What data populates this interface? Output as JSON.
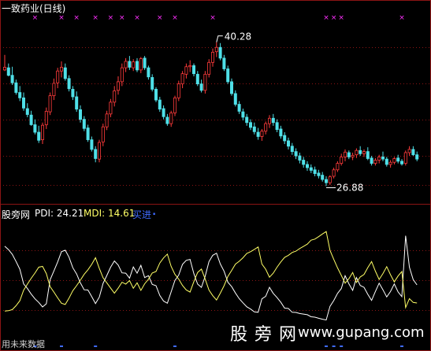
{
  "price_panel": {
    "title": "一致药业(日线)",
    "high_label": "40.28",
    "low_label": "26.88",
    "up_color": "#ff3b3b",
    "down_color": "#4fe0e8",
    "marker_color": "#ff30ff",
    "grid_color": "#8b1414"
  },
  "indicator_panel": {
    "name": "股旁网",
    "pdi_label": "PDI: 24.21",
    "mdi_label": "MDI: 14.61",
    "signal_label": "买进",
    "signal_arrow": "⬝",
    "pdi_color": "#ffffff",
    "mdi_color": "#ffff66",
    "signal_color": "#3f6bff"
  },
  "footer": {
    "left_caption": "用未来数据"
  },
  "watermark": {
    "cn": "股 旁 网",
    "url": "www.gupang.com"
  },
  "chart_data": [
    {
      "type": "candlestick",
      "title": "一致药业(日线)",
      "ylim": [
        25.6,
        42.6
      ],
      "ohlc": [
        [
          37.7,
          39.1,
          37.6,
          37.95
        ],
        [
          37.9,
          38.3,
          37.1,
          37.2
        ],
        [
          37.2,
          38.0,
          36.3,
          36.5
        ],
        [
          36.5,
          36.8,
          35.4,
          35.6
        ],
        [
          35.6,
          36.2,
          34.8,
          35.1
        ],
        [
          35.1,
          35.6,
          33.9,
          34.15
        ],
        [
          34.1,
          34.6,
          33.3,
          33.55
        ],
        [
          33.5,
          33.9,
          32.5,
          32.6
        ],
        [
          32.6,
          33.1,
          31.7,
          31.9
        ],
        [
          31.9,
          32.5,
          30.9,
          31.15
        ],
        [
          31.2,
          32.8,
          30.8,
          32.55
        ],
        [
          32.6,
          34.2,
          32.2,
          33.85
        ],
        [
          33.8,
          35.6,
          33.5,
          35.3
        ],
        [
          35.3,
          36.9,
          34.9,
          36.45
        ],
        [
          36.5,
          37.9,
          36.0,
          37.6
        ],
        [
          37.6,
          38.5,
          37.0,
          37.95
        ],
        [
          37.9,
          38.3,
          36.7,
          36.9
        ],
        [
          36.9,
          37.2,
          35.7,
          35.95
        ],
        [
          35.9,
          36.2,
          34.9,
          35.2
        ],
        [
          35.2,
          35.7,
          33.8,
          34.05
        ],
        [
          34.0,
          34.4,
          32.8,
          33.1
        ],
        [
          33.1,
          33.4,
          32.0,
          32.25
        ],
        [
          32.3,
          32.6,
          31.0,
          31.2
        ],
        [
          31.2,
          31.5,
          30.1,
          30.3
        ],
        [
          30.3,
          30.6,
          29.1,
          29.45
        ],
        [
          29.4,
          31.2,
          29.1,
          30.95
        ],
        [
          31.0,
          32.7,
          30.6,
          32.4
        ],
        [
          32.4,
          33.9,
          32.1,
          33.6
        ],
        [
          33.6,
          35.0,
          33.3,
          34.7
        ],
        [
          34.7,
          36.2,
          34.3,
          35.75
        ],
        [
          35.8,
          37.1,
          35.4,
          36.6
        ],
        [
          36.6,
          38.3,
          36.2,
          37.9
        ],
        [
          37.9,
          38.8,
          37.5,
          38.5
        ],
        [
          38.5,
          39.0,
          37.7,
          37.95
        ],
        [
          37.9,
          38.7,
          37.6,
          38.45
        ],
        [
          38.5,
          38.8,
          37.5,
          37.7
        ],
        [
          37.7,
          38.9,
          37.4,
          38.75
        ],
        [
          38.8,
          39.0,
          37.7,
          37.9
        ],
        [
          37.9,
          38.1,
          36.8,
          37.05
        ],
        [
          37.0,
          37.3,
          35.7,
          35.9
        ],
        [
          35.9,
          36.1,
          34.7,
          34.9
        ],
        [
          34.9,
          35.2,
          33.8,
          34.05
        ],
        [
          34.1,
          34.4,
          33.1,
          33.35
        ],
        [
          33.3,
          33.6,
          32.5,
          32.7
        ],
        [
          32.7,
          33.9,
          32.4,
          33.7
        ],
        [
          33.7,
          35.3,
          33.4,
          35.1
        ],
        [
          35.1,
          36.7,
          34.8,
          36.4
        ],
        [
          36.4,
          37.6,
          36.0,
          37.35
        ],
        [
          37.3,
          38.3,
          36.9,
          38.0
        ],
        [
          38.0,
          38.6,
          37.5,
          38.1
        ],
        [
          38.1,
          38.3,
          37.1,
          37.35
        ],
        [
          37.3,
          37.6,
          36.2,
          36.4
        ],
        [
          36.4,
          36.8,
          35.6,
          35.8
        ],
        [
          35.8,
          37.6,
          35.5,
          37.3
        ],
        [
          37.3,
          38.7,
          37.0,
          38.4
        ],
        [
          38.4,
          39.7,
          38.0,
          39.35
        ],
        [
          39.4,
          40.28,
          38.9,
          39.8
        ],
        [
          39.8,
          40.2,
          38.6,
          38.8
        ],
        [
          38.8,
          39.1,
          37.6,
          37.8
        ],
        [
          37.8,
          38.1,
          36.4,
          36.6
        ],
        [
          36.6,
          36.9,
          35.3,
          35.5
        ],
        [
          35.5,
          35.8,
          34.3,
          34.5
        ],
        [
          34.5,
          34.8,
          33.6,
          33.85
        ],
        [
          33.8,
          34.1,
          33.0,
          33.3
        ],
        [
          33.3,
          33.6,
          32.5,
          32.8
        ],
        [
          32.8,
          33.1,
          32.1,
          32.35
        ],
        [
          32.4,
          32.8,
          31.7,
          31.95
        ],
        [
          31.9,
          32.3,
          31.2,
          31.5
        ],
        [
          31.5,
          32.2,
          31.1,
          32.0
        ],
        [
          32.0,
          32.9,
          31.7,
          32.7
        ],
        [
          32.7,
          33.5,
          32.3,
          33.2
        ],
        [
          33.2,
          33.6,
          32.5,
          32.8
        ],
        [
          32.8,
          33.1,
          31.9,
          32.15
        ],
        [
          32.2,
          32.5,
          31.3,
          31.55
        ],
        [
          31.6,
          31.9,
          30.8,
          31.1
        ],
        [
          31.1,
          31.4,
          30.3,
          30.6
        ],
        [
          30.6,
          30.9,
          29.8,
          30.1
        ],
        [
          30.1,
          30.4,
          29.4,
          29.7
        ],
        [
          29.7,
          30.0,
          29.0,
          29.3
        ],
        [
          29.3,
          29.6,
          28.6,
          28.9
        ],
        [
          28.9,
          29.2,
          28.3,
          28.6
        ],
        [
          28.6,
          28.9,
          28.1,
          28.35
        ],
        [
          28.4,
          28.7,
          27.8,
          28.05
        ],
        [
          28.1,
          28.4,
          27.6,
          27.85
        ],
        [
          27.9,
          28.2,
          27.3,
          27.5
        ],
        [
          27.5,
          27.8,
          26.88,
          27.2
        ],
        [
          27.2,
          27.9,
          27.0,
          27.75
        ],
        [
          27.8,
          28.6,
          27.6,
          28.4
        ],
        [
          28.4,
          29.2,
          28.2,
          29.0
        ],
        [
          29.0,
          29.9,
          28.8,
          29.6
        ],
        [
          29.6,
          30.3,
          29.2,
          30.05
        ],
        [
          30.0,
          30.2,
          29.4,
          29.6
        ],
        [
          29.6,
          30.0,
          29.3,
          29.75
        ],
        [
          29.8,
          30.4,
          29.5,
          30.2
        ],
        [
          30.2,
          30.6,
          29.7,
          29.9
        ],
        [
          29.9,
          30.3,
          29.6,
          30.1
        ],
        [
          30.1,
          30.5,
          29.3,
          29.45
        ],
        [
          29.5,
          29.7,
          28.8,
          29.0
        ],
        [
          29.0,
          29.5,
          28.8,
          29.3
        ],
        [
          29.3,
          29.8,
          29.0,
          29.6
        ],
        [
          29.6,
          30.1,
          29.2,
          29.4
        ],
        [
          29.4,
          29.6,
          28.7,
          28.9
        ],
        [
          28.9,
          29.3,
          28.6,
          29.1
        ],
        [
          29.1,
          29.6,
          28.9,
          29.45
        ],
        [
          29.5,
          29.8,
          29.0,
          29.2
        ],
        [
          29.2,
          29.4,
          28.8,
          28.95
        ],
        [
          29.0,
          30.2,
          28.8,
          30.0
        ],
        [
          30.0,
          30.6,
          29.7,
          30.3
        ],
        [
          30.3,
          30.6,
          29.7,
          29.8
        ],
        [
          29.8,
          30.1,
          29.2,
          29.4
        ]
      ],
      "signal_marks": [
        8,
        15,
        19,
        24,
        28,
        31,
        35,
        41,
        45,
        55,
        85,
        87,
        89,
        105
      ]
    },
    {
      "type": "line",
      "series": [
        {
          "name": "PDI",
          "values": [
            44.7,
            42.9,
            40.4,
            36.6,
            32.5,
            24.7,
            22.3,
            19.3,
            16.8,
            14.9,
            12.5,
            14.2,
            26.9,
            31.6,
            36.4,
            41.8,
            42.6,
            38.9,
            33.3,
            30.0,
            25.3,
            21.6,
            21.5,
            18.0,
            14.3,
            17.7,
            25.0,
            29.2,
            33.6,
            36.9,
            34.7,
            30.6,
            30.4,
            27.8,
            33.7,
            30.4,
            34.6,
            28.1,
            29.1,
            24.5,
            23.8,
            18.6,
            15.6,
            14.5,
            20.5,
            26.6,
            29.4,
            35.1,
            37.2,
            37.7,
            30.2,
            24.6,
            22.9,
            28.8,
            36.5,
            39.9,
            41.0,
            35.3,
            31.4,
            25.6,
            23.3,
            19.9,
            16.9,
            14.7,
            12.6,
            11.4,
            9.9,
            9.7,
            16.8,
            18.1,
            22.9,
            19.7,
            17.5,
            15.0,
            11.9,
            11.7,
            9.7,
            9.6,
            9.0,
            8.7,
            8.4,
            7.3,
            7.1,
            6.5,
            6.0,
            5.6,
            12.8,
            15.9,
            19.7,
            22.3,
            29.1,
            24.8,
            21.3,
            28.1,
            23.9,
            22.9,
            19.2,
            16.0,
            20.7,
            25.1,
            21.6,
            17.8,
            20.7,
            24.7,
            20.5,
            18.0,
            50.3,
            33.6,
            27.0,
            24.2
          ]
        },
        {
          "name": "MDI",
          "values": [
            10.3,
            10.5,
            11.1,
            13.2,
            15.8,
            21.4,
            24.6,
            27.7,
            30.5,
            33.6,
            34.0,
            30.2,
            23.3,
            20.4,
            17.3,
            14.5,
            13.8,
            17.2,
            21.1,
            23.8,
            26.7,
            29.8,
            32.2,
            35.1,
            38.6,
            33.0,
            28.0,
            25.3,
            22.5,
            19.8,
            22.5,
            25.6,
            24.6,
            26.5,
            22.4,
            25.3,
            21.3,
            24.8,
            27.2,
            30.5,
            31.3,
            35.8,
            38.5,
            40.5,
            34.0,
            29.8,
            27.3,
            23.9,
            21.5,
            20.4,
            25.9,
            30.8,
            32.6,
            27.3,
            21.5,
            18.5,
            16.2,
            19.8,
            23.8,
            28.7,
            31.9,
            35.2,
            36.7,
            38.6,
            40.9,
            41.8,
            43.0,
            44.3,
            35.2,
            32.5,
            28.3,
            30.4,
            33.6,
            36.4,
            38.8,
            39.9,
            41.4,
            42.1,
            43.5,
            44.6,
            45.8,
            47.9,
            48.5,
            49.8,
            51.2,
            52.5,
            42.5,
            37.7,
            33.2,
            29.2,
            25.1,
            27.5,
            30.8,
            25.5,
            28.4,
            29.7,
            33.4,
            36.6,
            31.5,
            27.1,
            30.2,
            33.9,
            29.6,
            25.8,
            28.9,
            31.3,
            12.2,
            16.9,
            14.9,
            14.6
          ]
        }
      ],
      "ylim": [
        0,
        58
      ],
      "signal_marks": [
        8,
        15,
        24,
        45,
        85,
        87,
        89,
        105
      ]
    }
  ]
}
